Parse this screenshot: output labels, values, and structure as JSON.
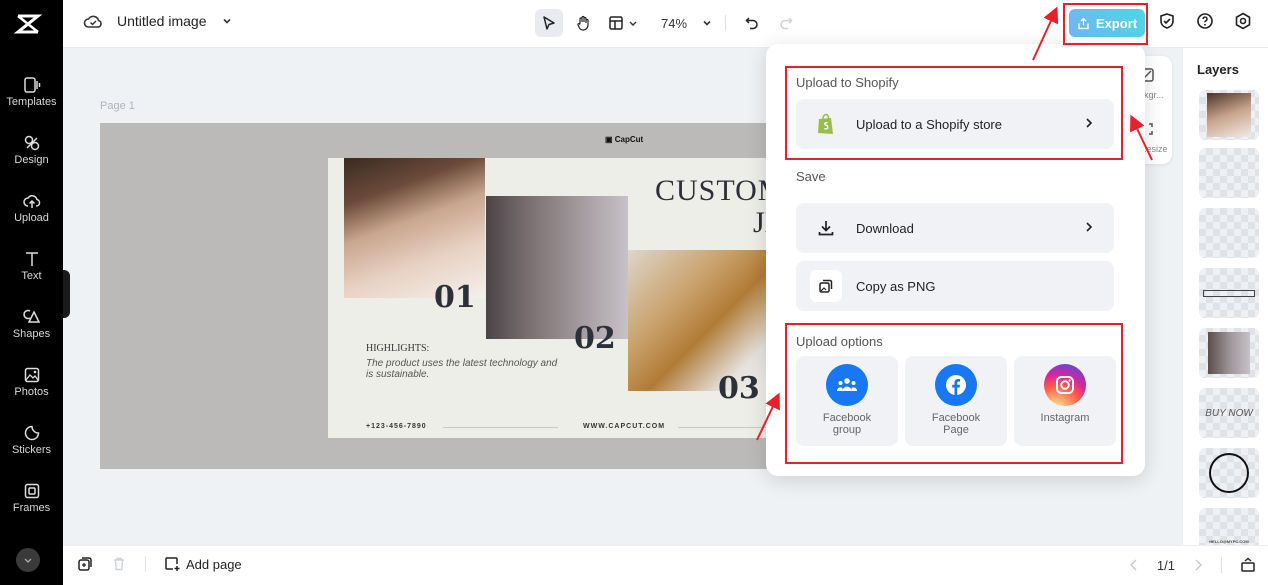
{
  "app": {
    "brand": "CapCut"
  },
  "topbar": {
    "doc_title": "Untitled image",
    "zoom_level": "74%",
    "export_label": "Export"
  },
  "sidebar": {
    "items": [
      {
        "label": "Templates",
        "icon": "templates-icon"
      },
      {
        "label": "Design",
        "icon": "design-icon"
      },
      {
        "label": "Upload",
        "icon": "upload-cloud-icon"
      },
      {
        "label": "Text",
        "icon": "text-icon"
      },
      {
        "label": "Shapes",
        "icon": "shapes-icon"
      },
      {
        "label": "Photos",
        "icon": "photos-icon"
      },
      {
        "label": "Stickers",
        "icon": "stickers-icon"
      },
      {
        "label": "Frames",
        "icon": "frames-icon"
      }
    ]
  },
  "canvas": {
    "page_label": "Page 1",
    "design": {
      "brand_mark": "CapCut",
      "title_line1": "CUSTOM",
      "title_line2": "JE",
      "numbers": [
        "01",
        "02",
        "03"
      ],
      "highlights_heading": "HIGHLIGHTS:",
      "highlights_body": "The product uses the latest technology and is sustainable.",
      "phone": "+123-456-7890",
      "website": "WWW.CAPCUT.COM"
    }
  },
  "mini_toolbar": {
    "items": [
      "Bkgr...",
      "Resize"
    ]
  },
  "layers": {
    "title": "Layers",
    "items": [
      "photo-necklace",
      "blank",
      "blank",
      "rectangle",
      "photo-pendants",
      "BUY NOW",
      "circle",
      "HELLO@MYPC.COM"
    ]
  },
  "export_menu": {
    "shopify_section": "Upload to Shopify",
    "shopify_item": "Upload to a Shopify store",
    "save_section": "Save",
    "download": "Download",
    "copy_png": "Copy as PNG",
    "upload_section": "Upload options",
    "upload_options": [
      {
        "line1": "Facebook",
        "line2": "group",
        "color": "#1877f2"
      },
      {
        "line1": "Facebook",
        "line2": "Page",
        "color": "#1877f2"
      },
      {
        "line1": "Instagram",
        "line2": "",
        "color": "#e1306c"
      }
    ]
  },
  "bottombar": {
    "add_page": "Add page",
    "pagination": "1/1"
  },
  "colors": {
    "accent_gradient_start": "#6fb8f2",
    "accent_gradient_end": "#4fd4e4",
    "annotation_red": "#e8202a",
    "shopify_green": "#95bf47"
  }
}
